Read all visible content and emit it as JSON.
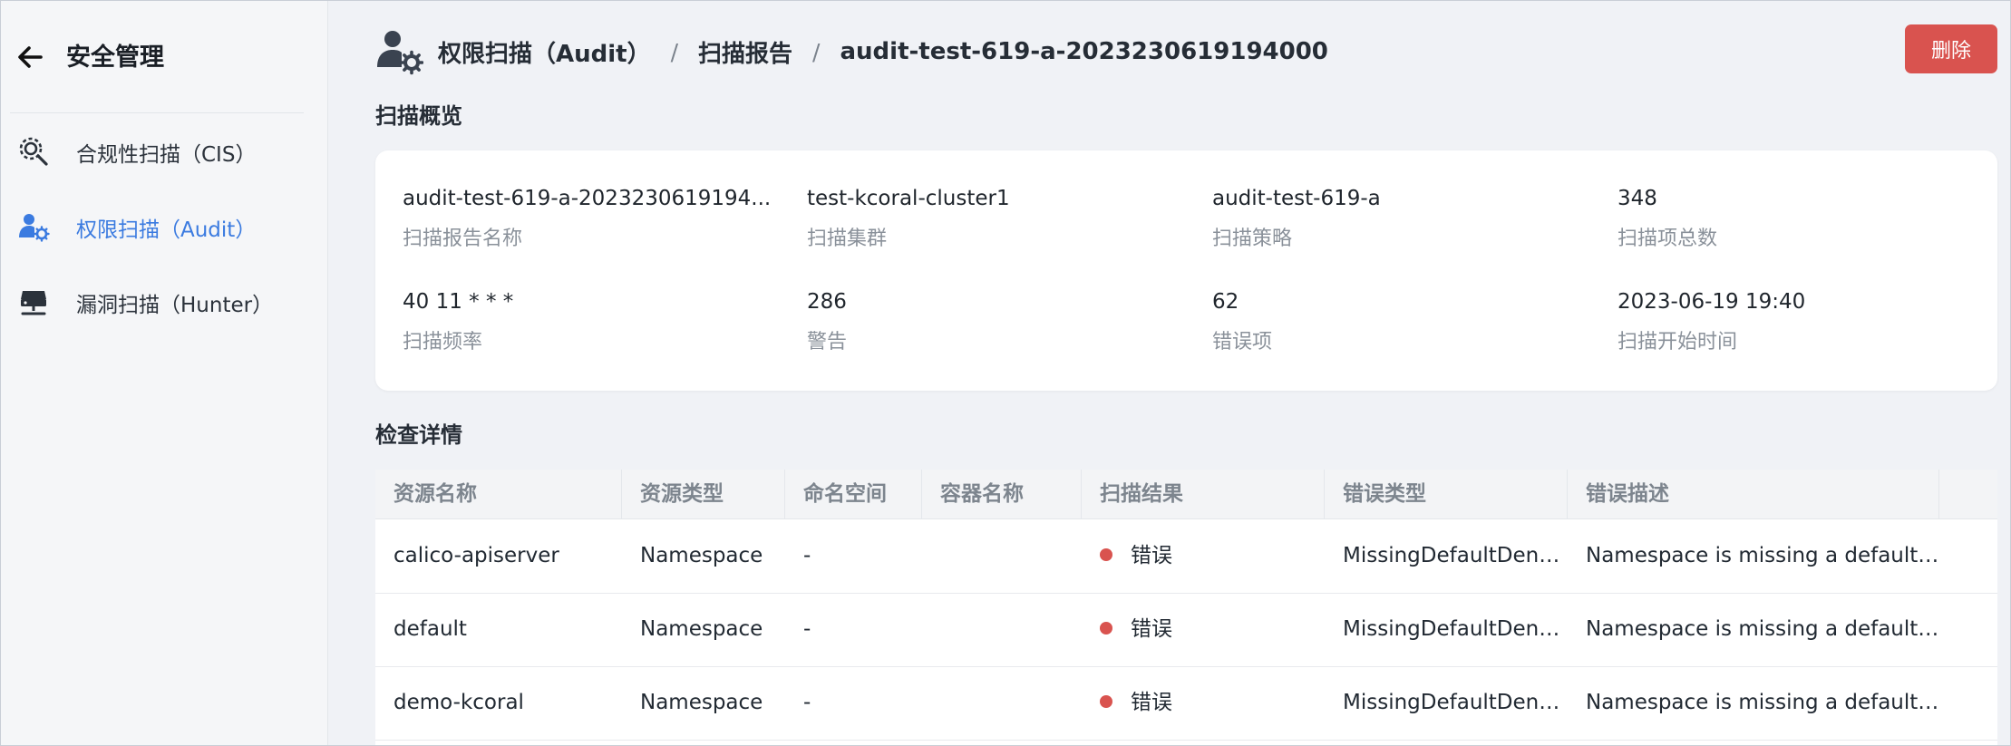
{
  "sidebar": {
    "title": "安全管理",
    "items": [
      {
        "label": "合规性扫描（CIS）",
        "icon": "compliance-scan-icon",
        "active": false
      },
      {
        "label": "权限扫描（Audit）",
        "icon": "permission-scan-icon",
        "active": true
      },
      {
        "label": "漏洞扫描（Hunter）",
        "icon": "vulnerability-scan-icon",
        "active": false
      }
    ]
  },
  "header": {
    "icon": "user-gear-icon",
    "breadcrumb": [
      "权限扫描（Audit）",
      "扫描报告",
      "audit-test-619-a-2023230619194000"
    ],
    "separator": "/",
    "delete_label": "删除"
  },
  "overview": {
    "title": "扫描概览",
    "items": [
      {
        "value": "audit-test-619-a-2023230619194...",
        "label": "扫描报告名称"
      },
      {
        "value": "test-kcoral-cluster1",
        "label": "扫描集群"
      },
      {
        "value": "audit-test-619-a",
        "label": "扫描策略"
      },
      {
        "value": "348",
        "label": "扫描项总数"
      },
      {
        "value": "40 11 * * *",
        "label": "扫描频率"
      },
      {
        "value": "286",
        "label": "警告"
      },
      {
        "value": "62",
        "label": "错误项"
      },
      {
        "value": "2023-06-19 19:40",
        "label": "扫描开始时间"
      }
    ]
  },
  "details": {
    "title": "检查详情",
    "columns": [
      "资源名称",
      "资源类型",
      "命名空间",
      "容器名称",
      "扫描结果",
      "错误类型",
      "错误描述"
    ],
    "rows": [
      {
        "name": "calico-apiserver",
        "type": "Namespace",
        "namespace": "-",
        "container": "",
        "result": "错误",
        "error_type": "MissingDefaultDeny...",
        "error_desc": "Namespace is missing a default d..."
      },
      {
        "name": "default",
        "type": "Namespace",
        "namespace": "-",
        "container": "",
        "result": "错误",
        "error_type": "MissingDefaultDeny...",
        "error_desc": "Namespace is missing a default d..."
      },
      {
        "name": "demo-kcoral",
        "type": "Namespace",
        "namespace": "-",
        "container": "",
        "result": "错误",
        "error_type": "MissingDefaultDeny...",
        "error_desc": "Namespace is missing a default d..."
      }
    ]
  },
  "colors": {
    "accent": "#3b7be0",
    "danger": "#d9534f",
    "background": "#f0f2f6",
    "sidebar_bg": "#f5f6f8"
  }
}
